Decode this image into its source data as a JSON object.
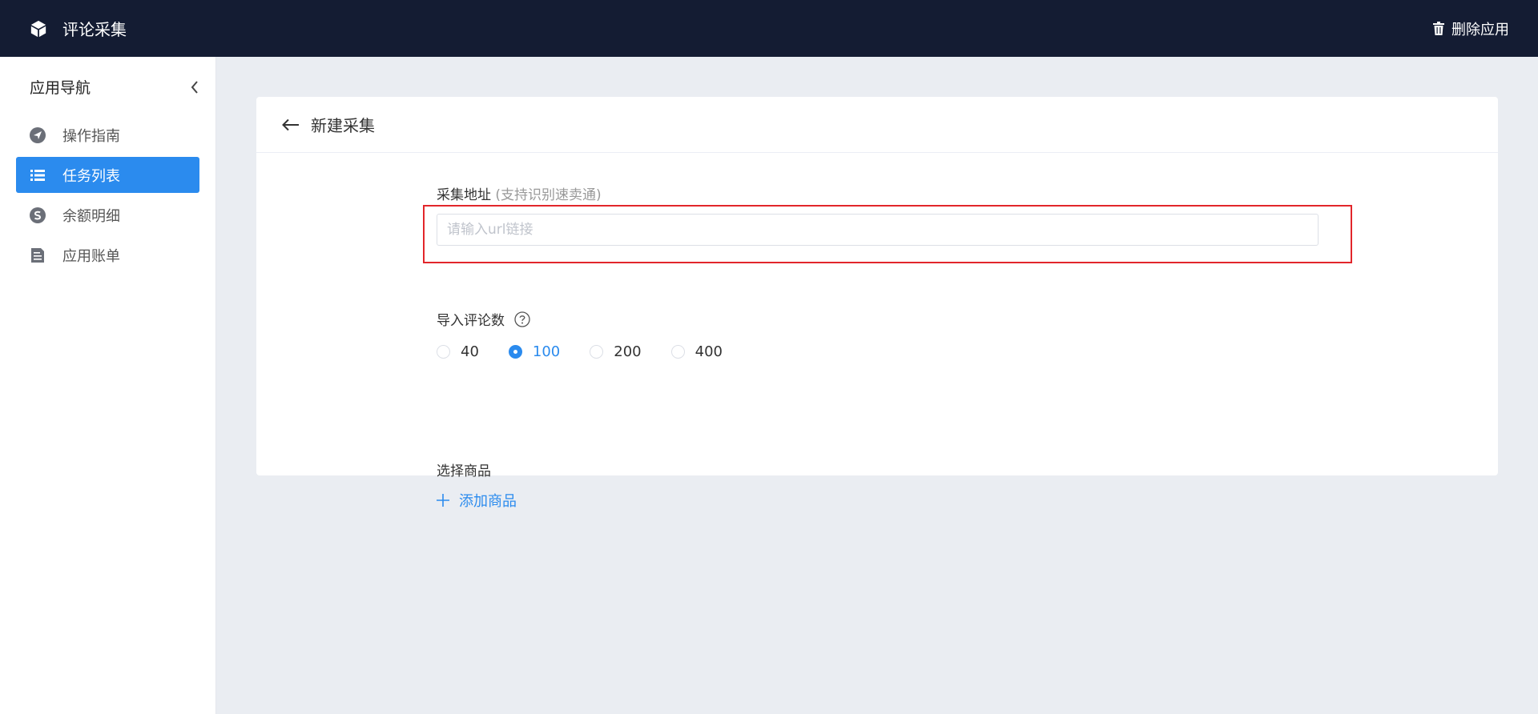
{
  "topbar": {
    "app_title": "评论采集",
    "delete_label": "删除应用",
    "bg_color": "#141c33"
  },
  "sidebar": {
    "title": "应用导航",
    "items": [
      {
        "label": "操作指南",
        "icon": "navigation-icon",
        "active": false
      },
      {
        "label": "任务列表",
        "icon": "list-icon",
        "active": true
      },
      {
        "label": "余额明细",
        "icon": "dollar-icon",
        "active": false
      },
      {
        "label": "应用账单",
        "icon": "bill-icon",
        "active": false
      }
    ]
  },
  "card": {
    "title": "新建采集"
  },
  "form": {
    "url_label": "采集地址",
    "url_hint": "(支持识别速卖通)",
    "url_placeholder": "请输入url链接",
    "url_value": "",
    "count_label": "导入评论数",
    "count_options": [
      "40",
      "100",
      "200",
      "400"
    ],
    "count_selected": "100",
    "goods_label": "选择商品",
    "add_goods_label": "添加商品"
  },
  "colors": {
    "accent": "#2b8bee",
    "highlight_border": "#e2262b"
  }
}
